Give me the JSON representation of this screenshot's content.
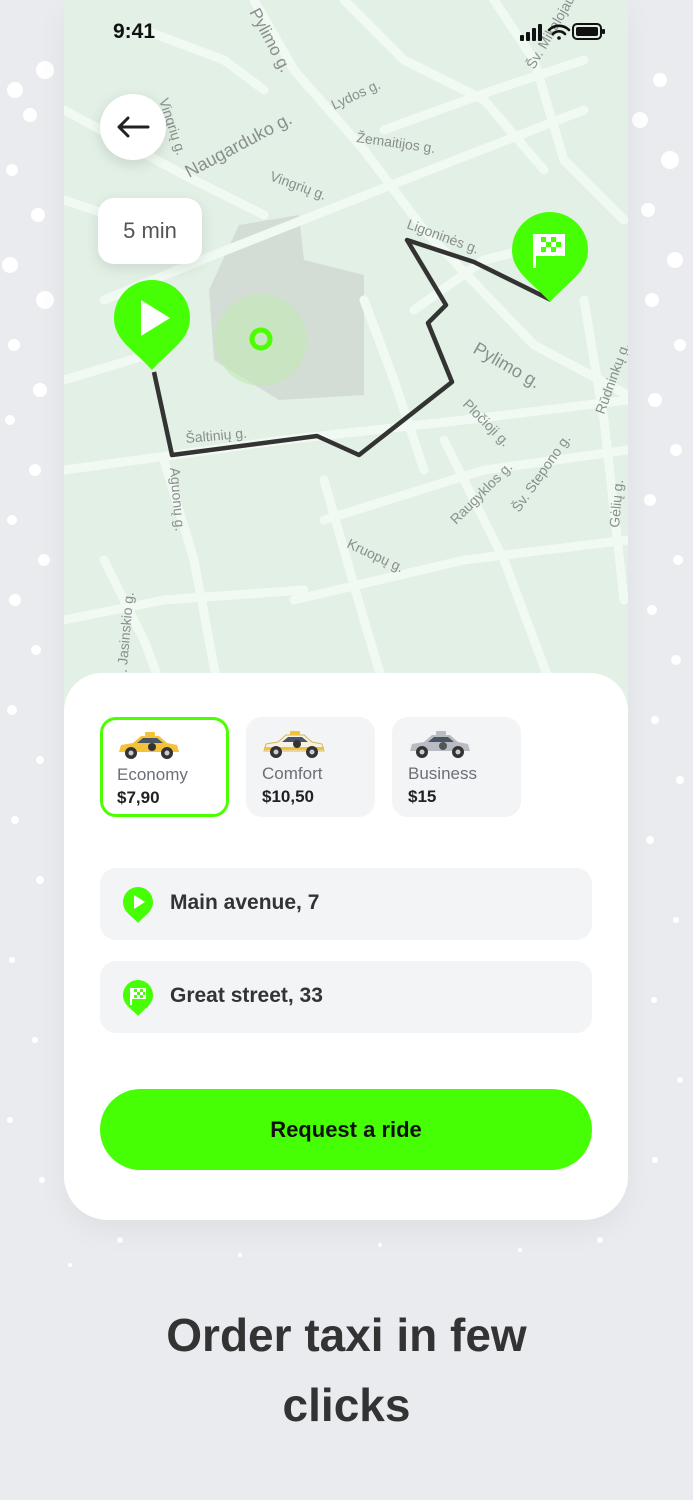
{
  "status_bar": {
    "time": "9:41"
  },
  "map": {
    "eta": "5 min",
    "streets": [
      "Pylimo g.",
      "Naugarduko g.",
      "Vingrių g.",
      "Vingrių g.",
      "Lydos g.",
      "Žemaitijos g.",
      "Ligoninės g.",
      "Pylimo g.",
      "Pločioji g.",
      "Šaltinių g.",
      "Aguonų g.",
      "Raugyklos g.",
      "Šv. Stepono g.",
      "Kruopų g.",
      "Rūdninkų g.",
      "Gėlių g.",
      "Šv. Mikalojaus g.",
      "J. Jasinskio g."
    ]
  },
  "ride_classes": [
    {
      "name": "Economy",
      "price": "$7,90",
      "selected": true
    },
    {
      "name": "Comfort",
      "price": "$10,50",
      "selected": false
    },
    {
      "name": "Business",
      "price": "$15",
      "selected": false
    }
  ],
  "route": {
    "from": "Main avenue, 7",
    "to": "Great street, 33"
  },
  "cta_label": "Request a ride",
  "caption": "Order taxi in few clicks",
  "colors": {
    "accent": "#47ff05",
    "map_bg": "#e3f1e7",
    "route": "#333333"
  }
}
